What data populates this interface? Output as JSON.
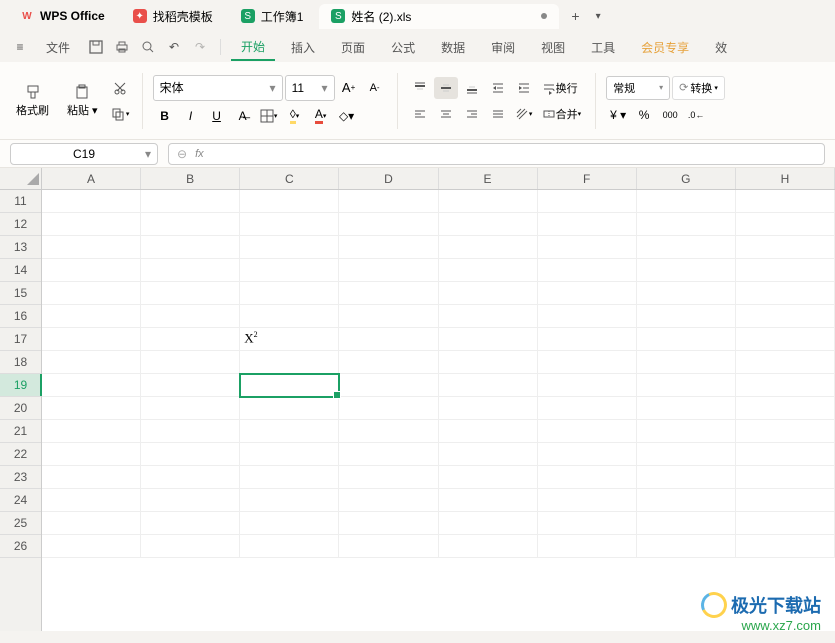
{
  "app_name": "WPS Office",
  "tabs": [
    {
      "label": "找稻壳模板",
      "icon_color": "#e94f4a"
    },
    {
      "label": "工作簿1",
      "icon_letter": "S",
      "icon_bg": "#1ba064"
    },
    {
      "label": "姓名 (2).xls",
      "icon_letter": "S",
      "icon_bg": "#1ba064",
      "active": true
    }
  ],
  "new_tab": "+",
  "menu": {
    "file": "文件",
    "tabs": [
      "开始",
      "插入",
      "页面",
      "公式",
      "数据",
      "审阅",
      "视图",
      "工具",
      "会员专享",
      "效"
    ],
    "active_tab": "开始"
  },
  "ribbon": {
    "format_brush": "格式刷",
    "paste": "粘贴",
    "font_name": "宋体",
    "font_size": "11",
    "wrap": "换行",
    "merge": "合并",
    "number_format": "常规",
    "convert": "转换"
  },
  "name_box": "C19",
  "fx_label": "fx",
  "columns": [
    "A",
    "B",
    "C",
    "D",
    "E",
    "F",
    "G",
    "H"
  ],
  "rows": [
    11,
    12,
    13,
    14,
    15,
    16,
    17,
    18,
    19,
    20,
    21,
    22,
    23,
    24,
    25,
    26
  ],
  "selected_cell": "C19",
  "selected_row": 19,
  "cell_content": {
    "row": 17,
    "col": "C",
    "text_base": "X",
    "text_sup": "2"
  },
  "watermark": {
    "title": "极光下载站",
    "url": "www.xz7.com"
  }
}
